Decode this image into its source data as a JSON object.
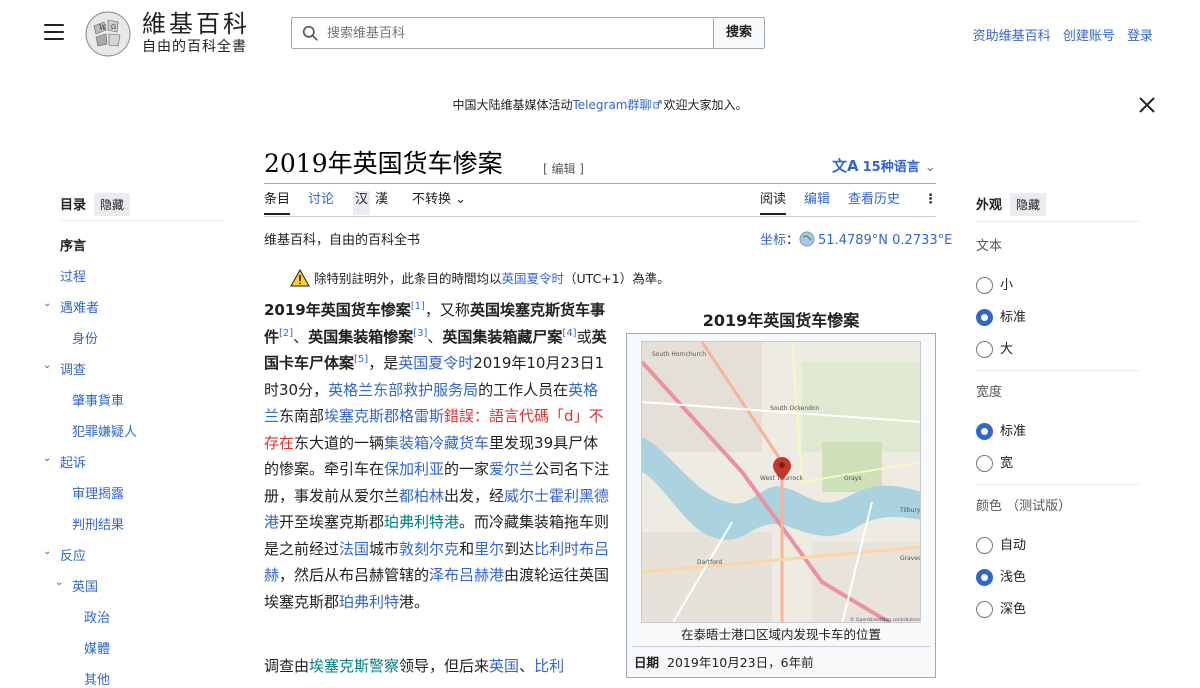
{
  "header": {
    "wordmark_line1": "維基百科",
    "wordmark_line2": "自由的百科全書",
    "search_placeholder": "搜索维基百科",
    "search_button": "搜索",
    "links": [
      "资助维基百科",
      "创建账号",
      "登录"
    ]
  },
  "banner": {
    "text_before": "中国大陆维基媒体活动",
    "link": "Telegram群聊",
    "text_after": "欢迎大家加入。"
  },
  "article": {
    "title": "2019年英国货车惨案",
    "edit_label": "[ 编辑 ]",
    "languages": "15种语言",
    "tabs_left": [
      "条目",
      "讨论",
      "汉",
      "漢",
      "不转换"
    ],
    "tabs_right": [
      "阅读",
      "编辑",
      "查看历史"
    ],
    "from": "维基百科，自由的百科全书",
    "coords_label": "坐标",
    "coords_value": "51.4789°N 0.2733°E",
    "tz_before": "除特别註明外，此条目的時間均以",
    "tz_link": "英国夏令时",
    "tz_after": "（UTC+1）為準。",
    "second_para_start": "调查由",
    "second_para_link1": "埃塞克斯警察",
    "second_para_mid": "领导，但后来",
    "second_para_link2": "英国",
    "second_para_sep": "、",
    "second_para_link3": "比利"
  },
  "lead": [
    {
      "t": "b",
      "v": "2019年英国货车惨案"
    },
    {
      "t": "sup",
      "v": "[1]"
    },
    {
      "t": "s",
      "v": "，又称"
    },
    {
      "t": "b",
      "v": "英国埃塞克斯货车事件"
    },
    {
      "t": "sup",
      "v": "[2]"
    },
    {
      "t": "s",
      "v": "、"
    },
    {
      "t": "b",
      "v": "英国集装箱惨案"
    },
    {
      "t": "sup",
      "v": "[3]"
    },
    {
      "t": "s",
      "v": "、"
    },
    {
      "t": "b",
      "v": "英国集装箱藏尸案"
    },
    {
      "t": "sup",
      "v": "[4]"
    },
    {
      "t": "s",
      "v": "或"
    },
    {
      "t": "b",
      "v": "英国卡车尸体案"
    },
    {
      "t": "sup",
      "v": "[5]"
    },
    {
      "t": "s",
      "v": "，是"
    },
    {
      "t": "a",
      "v": "英国夏令时"
    },
    {
      "t": "s",
      "v": "2019年10月23日1时30分，"
    },
    {
      "t": "a",
      "v": "英格兰东部救护服务局"
    },
    {
      "t": "s",
      "v": "的工作人员在"
    },
    {
      "t": "a",
      "v": "英格兰"
    },
    {
      "t": "s",
      "v": "东南部"
    },
    {
      "t": "a",
      "v": "埃塞克斯郡格雷斯"
    },
    {
      "t": "e",
      "v": "錯誤：語言代碼「d」不存在"
    },
    {
      "t": "s",
      "v": "东大道的一辆"
    },
    {
      "t": "a",
      "v": "集装箱冷藏货车"
    },
    {
      "t": "s",
      "v": "里发现39具尸体的惨案。牵引车在"
    },
    {
      "t": "a",
      "v": "保加利亚"
    },
    {
      "t": "s",
      "v": "的一家"
    },
    {
      "t": "a",
      "v": "爱尔兰"
    },
    {
      "t": "s",
      "v": "公司名下注册，事发前从爱尔兰"
    },
    {
      "t": "a",
      "v": "都柏林"
    },
    {
      "t": "s",
      "v": "出发，经"
    },
    {
      "t": "a",
      "v": "威尔士霍利黑德港"
    },
    {
      "t": "s",
      "v": "开至埃塞克斯郡"
    },
    {
      "t": "g",
      "v": "珀弗利特港"
    },
    {
      "t": "s",
      "v": "。而冷藏集装箱拖车则是之前经过"
    },
    {
      "t": "a",
      "v": "法国"
    },
    {
      "t": "s",
      "v": "城市"
    },
    {
      "t": "a",
      "v": "敦刻尔克"
    },
    {
      "t": "s",
      "v": "和"
    },
    {
      "t": "a",
      "v": "里尔"
    },
    {
      "t": "s",
      "v": "到达"
    },
    {
      "t": "a",
      "v": "比利时布吕赫"
    },
    {
      "t": "s",
      "v": "，然后从布吕赫管辖的"
    },
    {
      "t": "a",
      "v": "泽布吕赫港"
    },
    {
      "t": "s",
      "v": "由渡轮运往英国埃塞克斯郡"
    },
    {
      "t": "a",
      "v": "珀弗利特"
    },
    {
      "t": "s",
      "v": "港。"
    }
  ],
  "toc": {
    "heading": "目录",
    "hide": "隐藏",
    "items": [
      {
        "label": "序言",
        "level": 0,
        "chevron": false
      },
      {
        "label": "过程",
        "level": 0,
        "chevron": false
      },
      {
        "label": "遇难者",
        "level": 0,
        "chevron": true
      },
      {
        "label": "身份",
        "level": 1,
        "chevron": false
      },
      {
        "label": "调查",
        "level": 0,
        "chevron": true
      },
      {
        "label": "肇事貨車",
        "level": 1,
        "chevron": false
      },
      {
        "label": "犯罪嫌疑人",
        "level": 1,
        "chevron": false
      },
      {
        "label": "起诉",
        "level": 0,
        "chevron": true
      },
      {
        "label": "审理揭露",
        "level": 1,
        "chevron": false
      },
      {
        "label": "判刑结果",
        "level": 1,
        "chevron": false
      },
      {
        "label": "反应",
        "level": 0,
        "chevron": true
      },
      {
        "label": "英国",
        "level": 1,
        "chevron": true
      },
      {
        "label": "政治",
        "level": 2,
        "chevron": false
      },
      {
        "label": "媒體",
        "level": 2,
        "chevron": false
      },
      {
        "label": "其他",
        "level": 2,
        "chevron": false
      }
    ]
  },
  "appearance": {
    "heading": "外观",
    "hide": "隐藏",
    "sections": [
      {
        "label": "文本",
        "options": [
          {
            "label": "小",
            "on": false
          },
          {
            "label": "标准",
            "on": true
          },
          {
            "label": "大",
            "on": false
          }
        ]
      },
      {
        "label": "宽度",
        "options": [
          {
            "label": "标准",
            "on": true
          },
          {
            "label": "宽",
            "on": false
          }
        ]
      },
      {
        "label": "颜色 （测试版）",
        "options": [
          {
            "label": "自动",
            "on": false
          },
          {
            "label": "浅色",
            "on": true
          },
          {
            "label": "深色",
            "on": false
          }
        ]
      }
    ]
  },
  "infobox": {
    "title": "2019年英国货车惨案",
    "caption": "在泰晤士港口区域内发现卡车的位置",
    "date_label": "日期",
    "date_value": "2019年10月23日，6年前",
    "map_labels": [
      "South Hornchurch",
      "South Ockendon",
      "West Thurrock",
      "Grays",
      "Tilbury",
      "Dartford",
      "Gravesend",
      "© OpenStreetMap contributors"
    ]
  },
  "colors": {
    "link": "#3366cc",
    "error": "#dd3333",
    "teal": "#008080",
    "radio_on": "#3366cc"
  }
}
